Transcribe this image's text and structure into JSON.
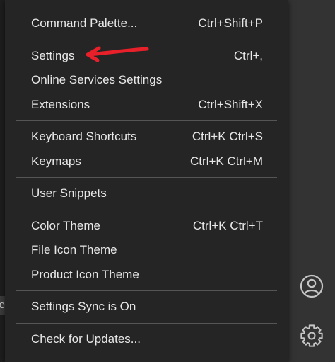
{
  "menu": {
    "groups": [
      [
        {
          "label": "Command Palette...",
          "shortcut": "Ctrl+Shift+P"
        }
      ],
      [
        {
          "label": "Settings",
          "shortcut": "Ctrl+,"
        },
        {
          "label": "Online Services Settings",
          "shortcut": ""
        },
        {
          "label": "Extensions",
          "shortcut": "Ctrl+Shift+X"
        }
      ],
      [
        {
          "label": "Keyboard Shortcuts",
          "shortcut": "Ctrl+K Ctrl+S"
        },
        {
          "label": "Keymaps",
          "shortcut": "Ctrl+K Ctrl+M"
        }
      ],
      [
        {
          "label": "User Snippets",
          "shortcut": ""
        }
      ],
      [
        {
          "label": "Color Theme",
          "shortcut": "Ctrl+K Ctrl+T"
        },
        {
          "label": "File Icon Theme",
          "shortcut": ""
        },
        {
          "label": "Product Icon Theme",
          "shortcut": ""
        }
      ],
      [
        {
          "label": "Settings Sync is On",
          "shortcut": ""
        }
      ],
      [
        {
          "label": "Check for Updates...",
          "shortcut": ""
        }
      ]
    ]
  },
  "left_snippet": "e",
  "activity_bar": {
    "icons": [
      {
        "name": "account-icon"
      },
      {
        "name": "gear-icon"
      }
    ]
  },
  "annotation": {
    "arrow_color": "#e8202a"
  }
}
